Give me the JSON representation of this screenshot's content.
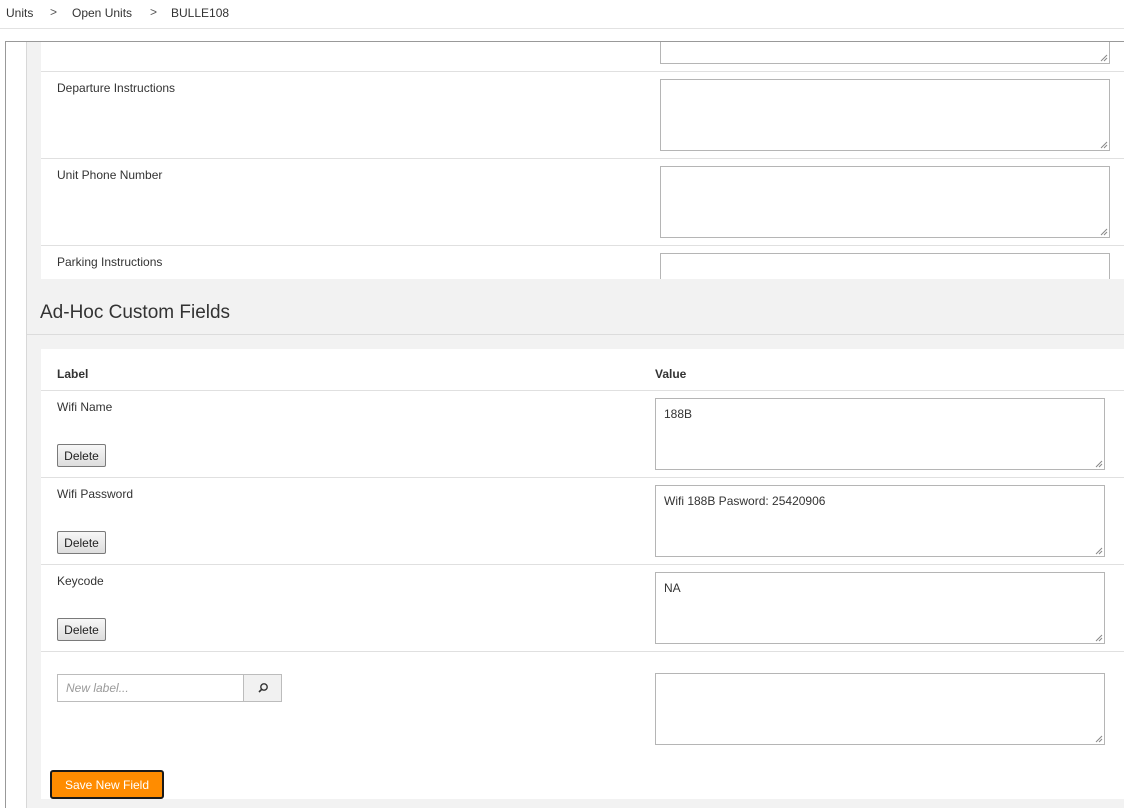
{
  "breadcrumb": {
    "items": [
      "Units",
      "Open Units",
      "BULLE108"
    ],
    "separator": ">"
  },
  "unit_fields": {
    "departure_instructions": {
      "label": "Departure Instructions",
      "value": ""
    },
    "unit_phone_number": {
      "label": "Unit Phone Number",
      "value": ""
    },
    "parking_instructions": {
      "label": "Parking Instructions",
      "value": ""
    }
  },
  "adhoc": {
    "title": "Ad-Hoc Custom Fields",
    "columns": {
      "label": "Label",
      "value": "Value"
    },
    "rows": [
      {
        "label": "Wifi Name",
        "value": "188B",
        "delete_label": "Delete"
      },
      {
        "label": "Wifi Password",
        "value": "Wifi 188B Pasword: 25420906",
        "delete_label": "Delete"
      },
      {
        "label": "Keycode",
        "value": "NA",
        "delete_label": "Delete"
      }
    ],
    "new_field": {
      "label_placeholder": "New label...",
      "value": "",
      "save_label": "Save New Field"
    }
  },
  "colors": {
    "accent": "#ff8c00",
    "background": "#f2f2f2"
  }
}
